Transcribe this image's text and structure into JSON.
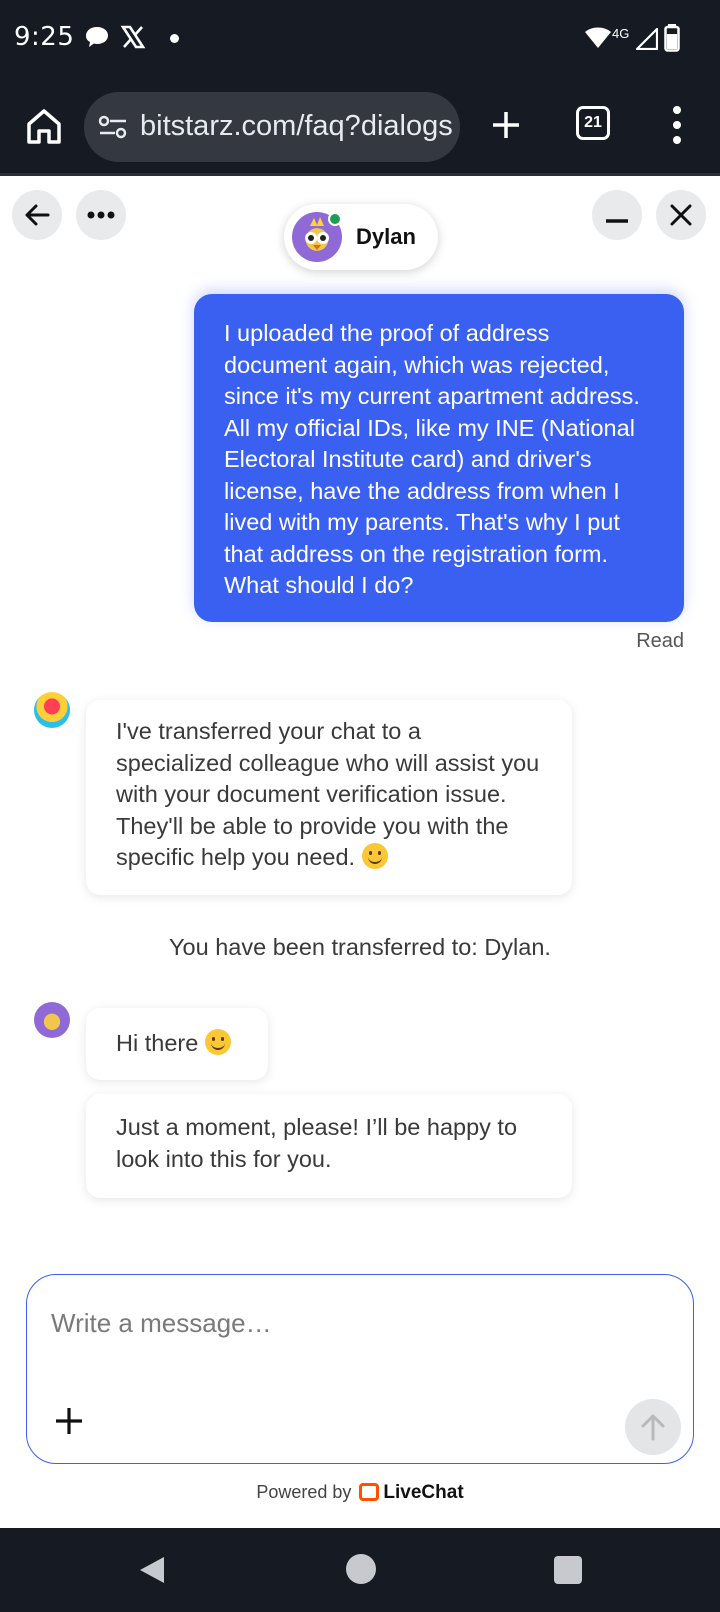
{
  "status_bar": {
    "time": "9:25",
    "network": "4G",
    "icons": [
      "chat-bubble-icon",
      "x-logo-icon",
      "wifi-icon",
      "signal-icon",
      "battery-icon"
    ]
  },
  "browser": {
    "url": "bitstarz.com/faq?dialogs",
    "tab_count": "21"
  },
  "chat": {
    "agent_name": "Dylan",
    "messages": {
      "user_message": "I uploaded the proof of address document again, which was rejected, since it's my current apartment address. All my official IDs, like my INE (National Electoral Institute card) and driver's license, have the address from when I lived with my parents. That's why I put that address on the registration form. What should I do?",
      "read_status": "Read",
      "bot_message": "I've transferred your chat to a specialized colleague who will assist you with your document verification issue. They'll be able to provide you with the specific help you need.",
      "system_message": "You have been transferred to: Dylan.",
      "agent_message_1": "Hi there",
      "agent_message_2": "Just a moment, please! I’ll be happy to look into this for you."
    }
  },
  "composer": {
    "placeholder": "Write a message…"
  },
  "footer": {
    "powered_by": "Powered by",
    "brand": "LiveChat"
  },
  "colors": {
    "accent": "#3960f0",
    "system_bar": "#161a22",
    "online": "#1f9d55",
    "livechat_orange": "#ff5100"
  }
}
